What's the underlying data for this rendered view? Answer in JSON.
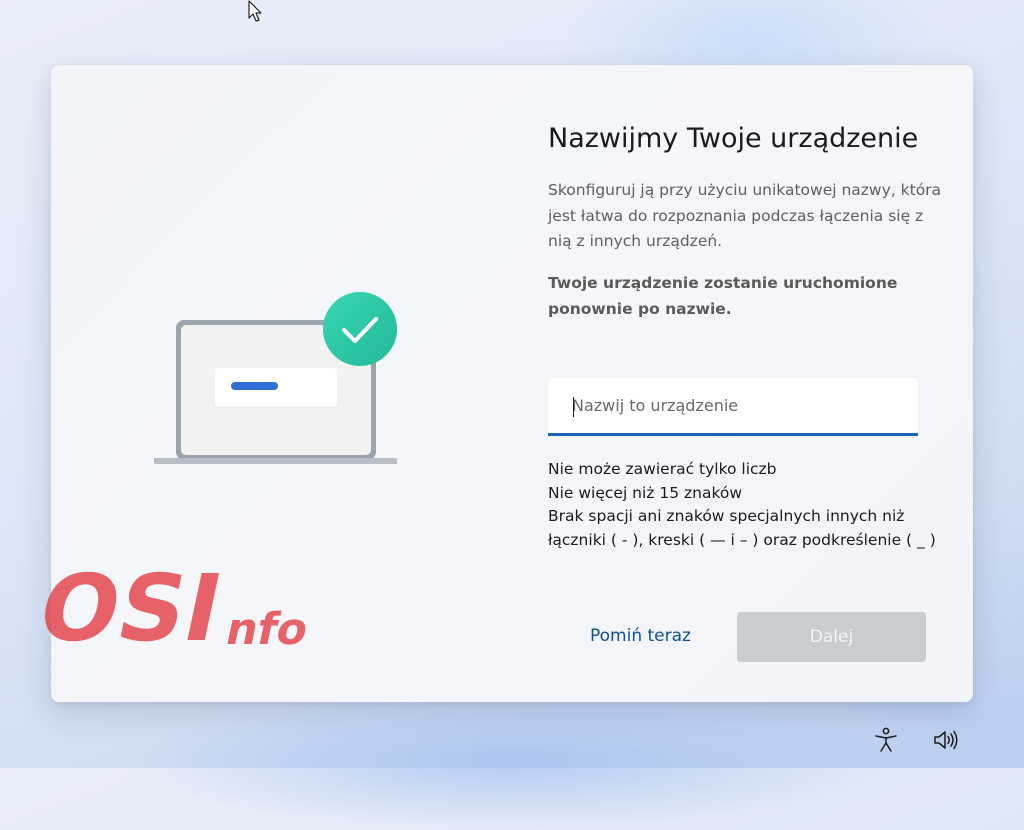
{
  "page": {
    "title": "Nazwijmy Twoje urządzenie",
    "description": "Skonfiguruj ją przy użyciu unikatowej nazwy, która jest łatwa do rozpoznania podczas łączenia się z nią z innych urządzeń.",
    "restart_note": "Twoje urządzenie zostanie uruchomione ponownie po nazwie."
  },
  "name_field": {
    "placeholder": "Nazwij to urządzenie",
    "value": ""
  },
  "rules": [
    "Nie może zawierać tylko liczb",
    "Nie więcej niż 15 znaków",
    "Brak spacji ani znaków specjalnych innych niż łączniki ( - ), kreski ( — i – ) oraz podkreślenie ( _ )"
  ],
  "actions": {
    "skip_label": "Pomiń teraz",
    "next_label": "Dalej",
    "next_enabled": false
  },
  "watermark": {
    "main": "OSI",
    "suffix": "nfo"
  },
  "icons": {
    "accessibility": "accessibility-icon",
    "volume": "volume-icon",
    "check": "checkmark-icon",
    "cursor": "mouse-pointer-icon"
  },
  "colors": {
    "accent": "#1a63b2",
    "link": "#0e4f8f",
    "check_badge": "#2ccaa5",
    "disabled_button": "#c9ccd1",
    "watermark": "#e3383f"
  }
}
